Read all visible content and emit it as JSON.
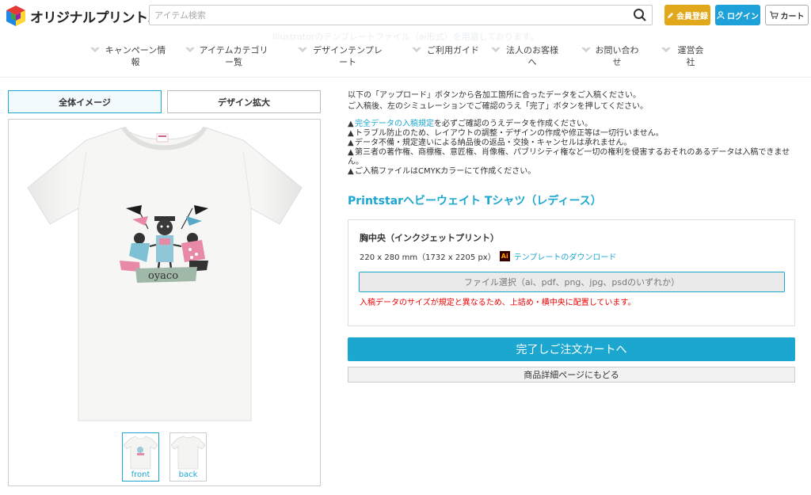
{
  "header": {
    "logo_text": "オリジナルプリント.jp",
    "search_placeholder": "アイテム検索",
    "register_label": "会員登録",
    "login_label": "ログイン",
    "cart_label": "カート"
  },
  "ghost_banner": {
    "line1": "Illustratorのテンプレートファイル（ai形式）を用意しております。"
  },
  "nav": [
    {
      "label": "キャンペーン情報"
    },
    {
      "label": "アイテムカテゴリー覧"
    },
    {
      "label": "デザインテンプレート"
    },
    {
      "label": "ご利用ガイド"
    },
    {
      "label": "法人のお客様へ"
    },
    {
      "label": "お問い合わせ"
    },
    {
      "label": "運営会社"
    }
  ],
  "tabs": {
    "overview": "全体イメージ",
    "zoom": "デザイン拡大"
  },
  "thumbs": {
    "front": "front",
    "back": "back"
  },
  "instructions": {
    "line1": "以下の「アップロード」ボタンから各加工箇所に合ったデータをご入稿ください。",
    "line2": "ご入稿後、左のシミュレーションでご確認のうえ「完了」ボタンを押してください。"
  },
  "warnings": {
    "w1_link": "完全データの入稿規定",
    "w1_rest": "を必ずご確認のうえデータを作成ください。",
    "w2": "トラブル防止のため、レイアウトの調整・デザインの作成や修正等は一切行いません。",
    "w3": "データ不備・規定違いによる納品後の返品・交換・キャンセルは承れません。",
    "w4": "第三者の著作権、商標権、意匠権、肖像権、パブリシティ権など一切の権利を侵害するおそれのあるデータは入稿できません。",
    "w5": "ご入稿ファイルはCMYKカラーにて作成ください。"
  },
  "product": {
    "title": "Printstarヘビーウェイト Tシャツ（レディース）"
  },
  "print_area": {
    "title": "胸中央（インクジェットプリント）",
    "size": "220 x 280 mm（1732 x 2205 px）",
    "ai_icon": "Ai",
    "template_link": "テンプレートのダウンロード",
    "file_select": "ファイル選択（ai、pdf、png、jpg、psdのいずれか）",
    "warning": "入稿データのサイズが規定と異なるため、上詰め・横中央に配置しています。"
  },
  "actions": {
    "order": "完了しご注文カートへ",
    "back": "商品詳細ページにもどる"
  },
  "design": {
    "banner_text": "oyaco"
  },
  "colors": {
    "accent": "#1ba7cf",
    "register": "#e0a81a",
    "login": "#1da1d8",
    "error": "#ee0000"
  }
}
